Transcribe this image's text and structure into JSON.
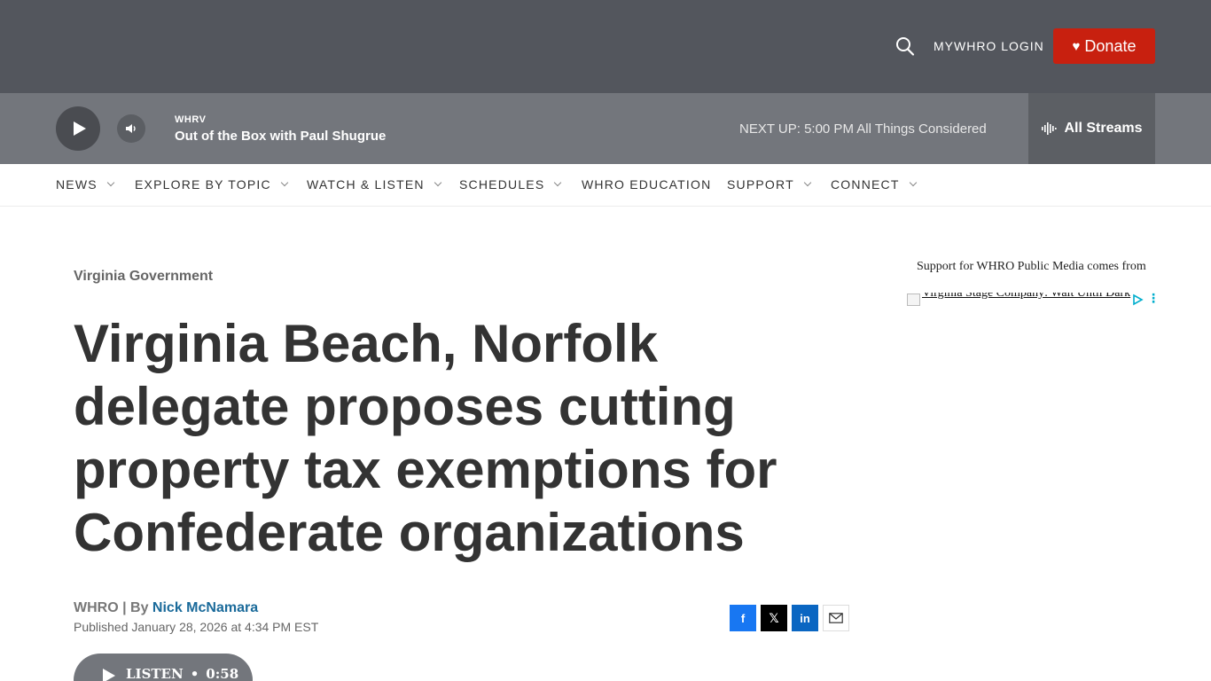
{
  "header": {
    "login_label": "MYWHRO LOGIN",
    "donate_label": "Donate",
    "colors": {
      "header_bg": "#53565d",
      "player_bg": "#73767c",
      "donate": "#c8200f"
    }
  },
  "player": {
    "station": "WHRV",
    "show": "Out of the Box with Paul Shugrue",
    "next_up": "NEXT UP: 5:00 PM All Things Considered",
    "streams_label": "All Streams"
  },
  "nav": {
    "items": [
      {
        "label": "NEWS"
      },
      {
        "label": "EXPLORE BY TOPIC"
      },
      {
        "label": "WATCH & LISTEN"
      },
      {
        "label": "SCHEDULES"
      },
      {
        "label": "WHRO EDUCATION"
      },
      {
        "label": "SUPPORT"
      },
      {
        "label": "CONNECT"
      }
    ]
  },
  "article": {
    "category": "Virginia Government",
    "headline": "Virginia Beach, Norfolk delegate proposes cutting property tax exemptions for Confederate organizations",
    "source": "WHRO",
    "by_prefix": " | By ",
    "author": "Nick McNamara",
    "published": "Published January 28, 2026 at 4:34 PM EST",
    "listen_label": "LISTEN",
    "listen_sep": "•",
    "listen_duration": "0:58"
  },
  "share": {
    "facebook": "f",
    "x": "𝕏",
    "linkedin": "in"
  },
  "sidebar": {
    "support_text": "Support for WHRO Public Media comes from",
    "ad_alt_text": "Virginia Stage Company: Wait Until Dark"
  }
}
